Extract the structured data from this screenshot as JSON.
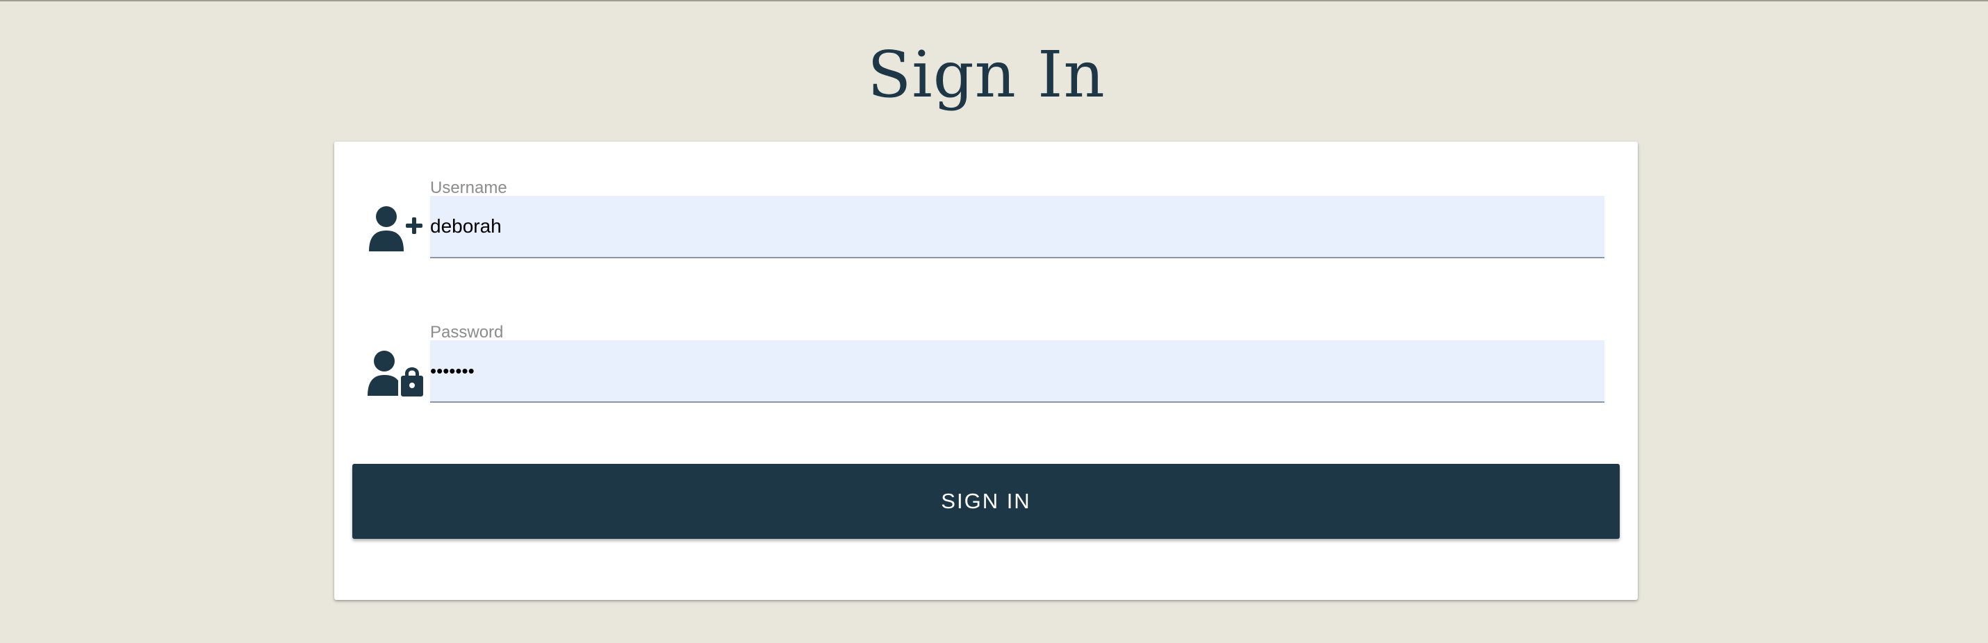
{
  "page": {
    "title": "Sign In"
  },
  "form": {
    "username": {
      "label": "Username",
      "value": "deborah",
      "icon": "user-plus-icon"
    },
    "password": {
      "label": "Password",
      "value": "•••••••",
      "icon": "user-lock-icon"
    },
    "submit_label": "SIGN IN"
  },
  "colors": {
    "background": "#e9e7dc",
    "primary": "#1e3747",
    "input_fill": "#e8f0fd",
    "card": "#ffffff"
  }
}
